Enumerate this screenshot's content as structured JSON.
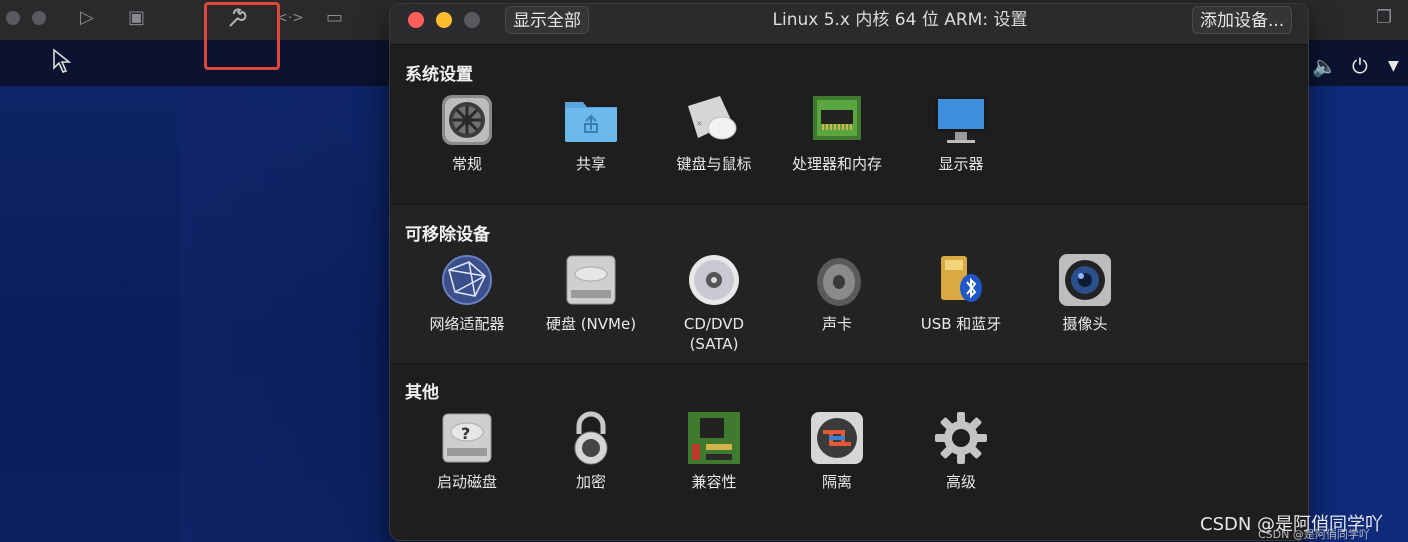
{
  "background": {
    "toolbar_icons": [
      "play-icon",
      "snapshot-icon",
      "wrench-icon",
      "code-icon",
      "disk-icon"
    ],
    "status_icons": [
      "volume-icon",
      "power-icon",
      "chevron-down-icon"
    ]
  },
  "window": {
    "title": "Linux 5.x 内核 64 位 ARM: 设置",
    "show_all_label": "显示全部",
    "add_device_label": "添加设备..."
  },
  "sections": {
    "system": {
      "title": "系统设置",
      "items": [
        {
          "label": "常规",
          "icon": "general-icon"
        },
        {
          "label": "共享",
          "icon": "shared-folder-icon"
        },
        {
          "label": "键盘与鼠标",
          "icon": "keyboard-mouse-icon"
        },
        {
          "label": "处理器和内存",
          "icon": "processor-memory-icon"
        },
        {
          "label": "显示器",
          "icon": "display-icon"
        }
      ]
    },
    "removable": {
      "title": "可移除设备",
      "items": [
        {
          "label": "网络适配器",
          "icon": "network-globe-icon"
        },
        {
          "label": "硬盘 (NVMe)",
          "icon": "hard-disk-icon"
        },
        {
          "label": "CD/DVD\n(SATA)",
          "icon": "cd-dvd-icon"
        },
        {
          "label": "声卡",
          "icon": "speaker-icon"
        },
        {
          "label": "USB 和蓝牙",
          "icon": "usb-bluetooth-icon"
        },
        {
          "label": "摄像头",
          "icon": "camera-icon"
        }
      ]
    },
    "other": {
      "title": "其他",
      "items": [
        {
          "label": "启动磁盘",
          "icon": "startup-disk-icon"
        },
        {
          "label": "加密",
          "icon": "padlock-icon"
        },
        {
          "label": "兼容性",
          "icon": "circuit-board-icon"
        },
        {
          "label": "隔离",
          "icon": "isolation-icon"
        },
        {
          "label": "高级",
          "icon": "advanced-gear-icon"
        }
      ]
    }
  },
  "watermark": {
    "main": "CSDN @是阿俏同学吖",
    "small": "CSDN @是阿俏同学吖"
  },
  "colors": {
    "window_bg": "#1e1e1e",
    "titlebar_bg": "#2b2b2d",
    "close": "#ff5f57",
    "minimize": "#febc2e",
    "zoom_inactive": "#5a5a5e",
    "highlight_box": "#e0463a",
    "desktop_blue": "#0d2466"
  }
}
